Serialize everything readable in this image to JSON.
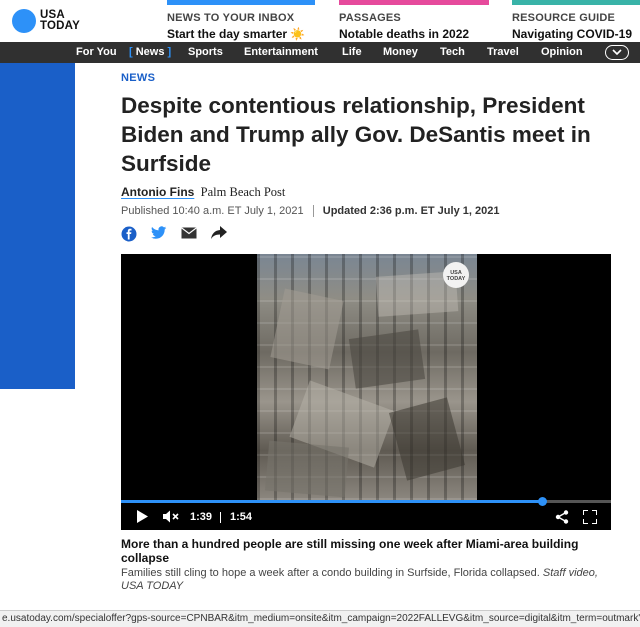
{
  "logo": {
    "line1": "USA",
    "line2": "TODAY"
  },
  "promos": [
    {
      "kicker": "NEWS TO YOUR INBOX",
      "head": "Start the day smarter ☀️"
    },
    {
      "kicker": "PASSAGES",
      "head": "Notable deaths in 2022"
    },
    {
      "kicker": "RESOURCE GUIDE",
      "head": "Navigating COVID-19"
    }
  ],
  "nav": {
    "items": [
      "For You",
      "News",
      "Sports",
      "Entertainment",
      "Life",
      "Money",
      "Tech",
      "Travel",
      "Opinion"
    ],
    "active": "News",
    "active_left_bracket": "[",
    "active_right_bracket": "]"
  },
  "article": {
    "section": "NEWS",
    "headline": "Despite contentious relationship, President Biden and Trump ally Gov. DeSantis meet in Surfside",
    "author": "Antonio Fins",
    "outlet": "Palm Beach Post",
    "published": "Published 10:40 a.m. ET July 1, 2021",
    "updated": "Updated 2:36 p.m. ET July 1, 2021"
  },
  "share_icons": [
    "facebook-icon",
    "twitter-icon",
    "email-icon",
    "share-arrow-icon"
  ],
  "video": {
    "badge_line1": "USA",
    "badge_line2": "TODAY",
    "current_time": "1:39",
    "duration": "1:54",
    "progress": 0.86,
    "caption_title": "More than a hundred people are still missing one week after Miami-area building collapse",
    "caption_text": "Families still cling to hope a week after a condo building in Surfside, Florida collapsed.",
    "caption_credit": "Staff video, USA TODAY"
  },
  "status_url": "e.usatoday.com/specialoffer?gps-source=CPNBAR&itm_medium=onsite&itm_campaign=2022FALLEVG&itm_source=digital&itm_term=outmark\" in a new",
  "colors": {
    "accent": "#2d91f8",
    "nav_bg": "#303030",
    "section": "#1a5fc8"
  }
}
